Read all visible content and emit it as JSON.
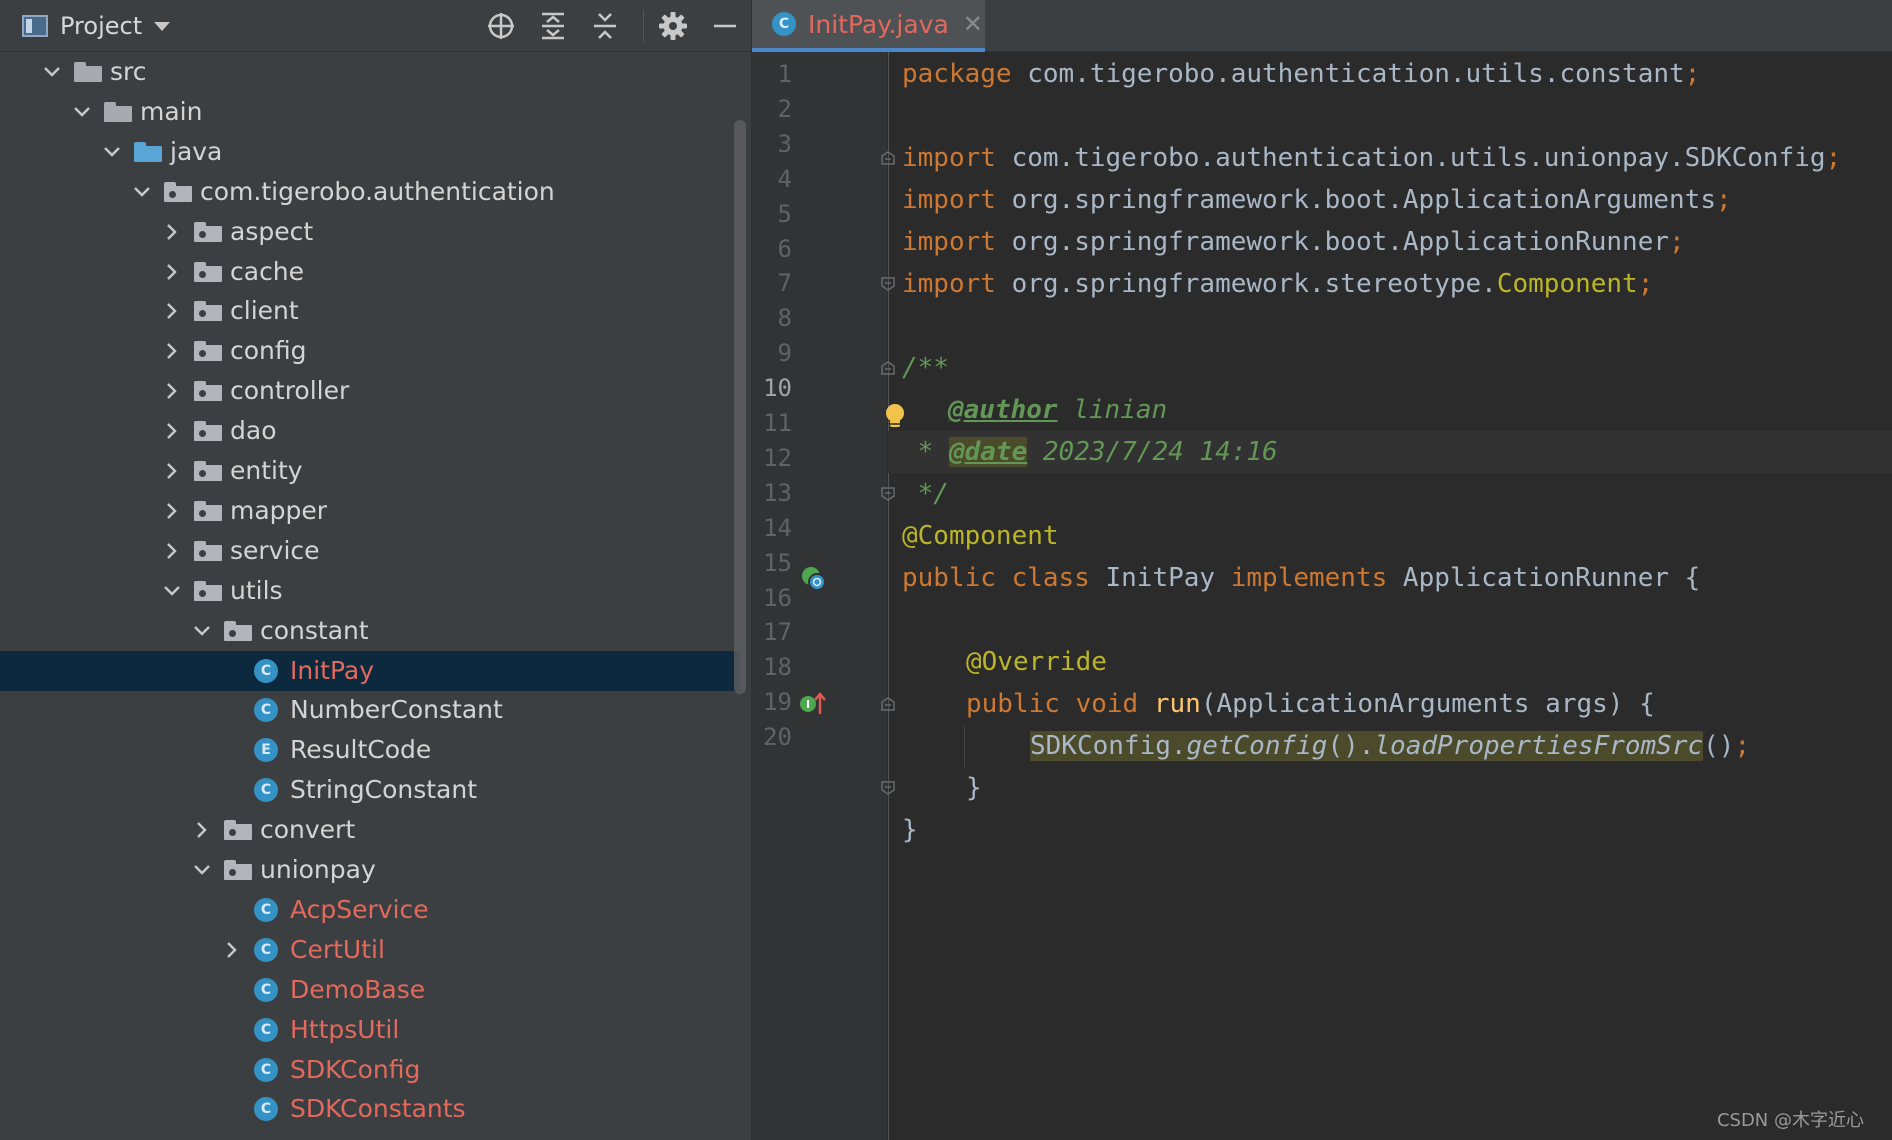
{
  "project_panel": {
    "title": "Project",
    "tree": [
      {
        "label": "src",
        "depth": 0,
        "expanded": true,
        "kind": "folder-src"
      },
      {
        "label": "main",
        "depth": 1,
        "expanded": true,
        "kind": "folder-src"
      },
      {
        "label": "java",
        "depth": 2,
        "expanded": true,
        "kind": "folder-java"
      },
      {
        "label": "com.tigerobo.authentication",
        "depth": 3,
        "expanded": true,
        "kind": "package"
      },
      {
        "label": "aspect",
        "depth": 4,
        "expanded": false,
        "kind": "package"
      },
      {
        "label": "cache",
        "depth": 4,
        "expanded": false,
        "kind": "package"
      },
      {
        "label": "client",
        "depth": 4,
        "expanded": false,
        "kind": "package"
      },
      {
        "label": "config",
        "depth": 4,
        "expanded": false,
        "kind": "package"
      },
      {
        "label": "controller",
        "depth": 4,
        "expanded": false,
        "kind": "package"
      },
      {
        "label": "dao",
        "depth": 4,
        "expanded": false,
        "kind": "package"
      },
      {
        "label": "entity",
        "depth": 4,
        "expanded": false,
        "kind": "package"
      },
      {
        "label": "mapper",
        "depth": 4,
        "expanded": false,
        "kind": "package"
      },
      {
        "label": "service",
        "depth": 4,
        "expanded": false,
        "kind": "package"
      },
      {
        "label": "utils",
        "depth": 4,
        "expanded": true,
        "kind": "package"
      },
      {
        "label": "constant",
        "depth": 5,
        "expanded": true,
        "kind": "package"
      },
      {
        "label": "InitPay",
        "depth": 6,
        "kind": "class",
        "badge": "C",
        "red": true,
        "selected": true
      },
      {
        "label": "NumberConstant",
        "depth": 6,
        "kind": "class",
        "badge": "C"
      },
      {
        "label": "ResultCode",
        "depth": 6,
        "kind": "class",
        "badge": "E"
      },
      {
        "label": "StringConstant",
        "depth": 6,
        "kind": "class",
        "badge": "C"
      },
      {
        "label": "convert",
        "depth": 5,
        "expanded": false,
        "kind": "package"
      },
      {
        "label": "unionpay",
        "depth": 5,
        "expanded": true,
        "kind": "package"
      },
      {
        "label": "AcpService",
        "depth": 6,
        "kind": "class",
        "badge": "C",
        "red": true
      },
      {
        "label": "CertUtil",
        "depth": 6,
        "kind": "class",
        "badge": "C",
        "red": true,
        "collapsible": true
      },
      {
        "label": "DemoBase",
        "depth": 6,
        "kind": "class",
        "badge": "C",
        "red": true
      },
      {
        "label": "HttpsUtil",
        "depth": 6,
        "kind": "class",
        "badge": "C",
        "red": true
      },
      {
        "label": "SDKConfig",
        "depth": 6,
        "kind": "class",
        "badge": "C",
        "red": true
      },
      {
        "label": "SDKConstants",
        "depth": 6,
        "kind": "class",
        "badge": "C",
        "red": true
      }
    ]
  },
  "editor": {
    "tab": {
      "label": "InitPay.java",
      "badge": "C"
    },
    "current_line": 10,
    "lines": {
      "l1": [
        "package",
        " com.tigerobo.authentication.utils.constant",
        ";"
      ],
      "l3": [
        "import",
        " com.tigerobo.authentication.utils.unionpay.SDKConfig",
        ";"
      ],
      "l4": [
        "import",
        " org.springframework.boot.ApplicationArguments",
        ";"
      ],
      "l5": [
        "import",
        " org.springframework.boot.ApplicationRunner",
        ";"
      ],
      "l6": [
        "import",
        " org.springframework.stereotype.",
        "Component",
        ";"
      ],
      "l8": "/**",
      "l9": [
        "@author",
        " linian"
      ],
      "l10": [
        " * ",
        "@date",
        " 2023/7/24 14:16"
      ],
      "l11": " */",
      "l12": "@Component",
      "l13": [
        "public class ",
        "InitPay ",
        "implements ",
        "ApplicationRunner {"
      ],
      "l15": "@Override",
      "l16": [
        "public void ",
        "run",
        "(ApplicationArguments args) {"
      ],
      "l17": [
        "SDKConfig.",
        "getConfig",
        "().",
        "loadPropertiesFromSrc",
        "()",
        ";"
      ],
      "l18": "}",
      "l19": "}"
    }
  },
  "watermark": "CSDN @木字近心",
  "colors": {
    "keyword": "#cc7832",
    "annotation": "#bbb529",
    "doc_comment": "#629755",
    "method": "#ffc66d",
    "modified_file": "#e2695c",
    "selection": "#0d293e"
  }
}
